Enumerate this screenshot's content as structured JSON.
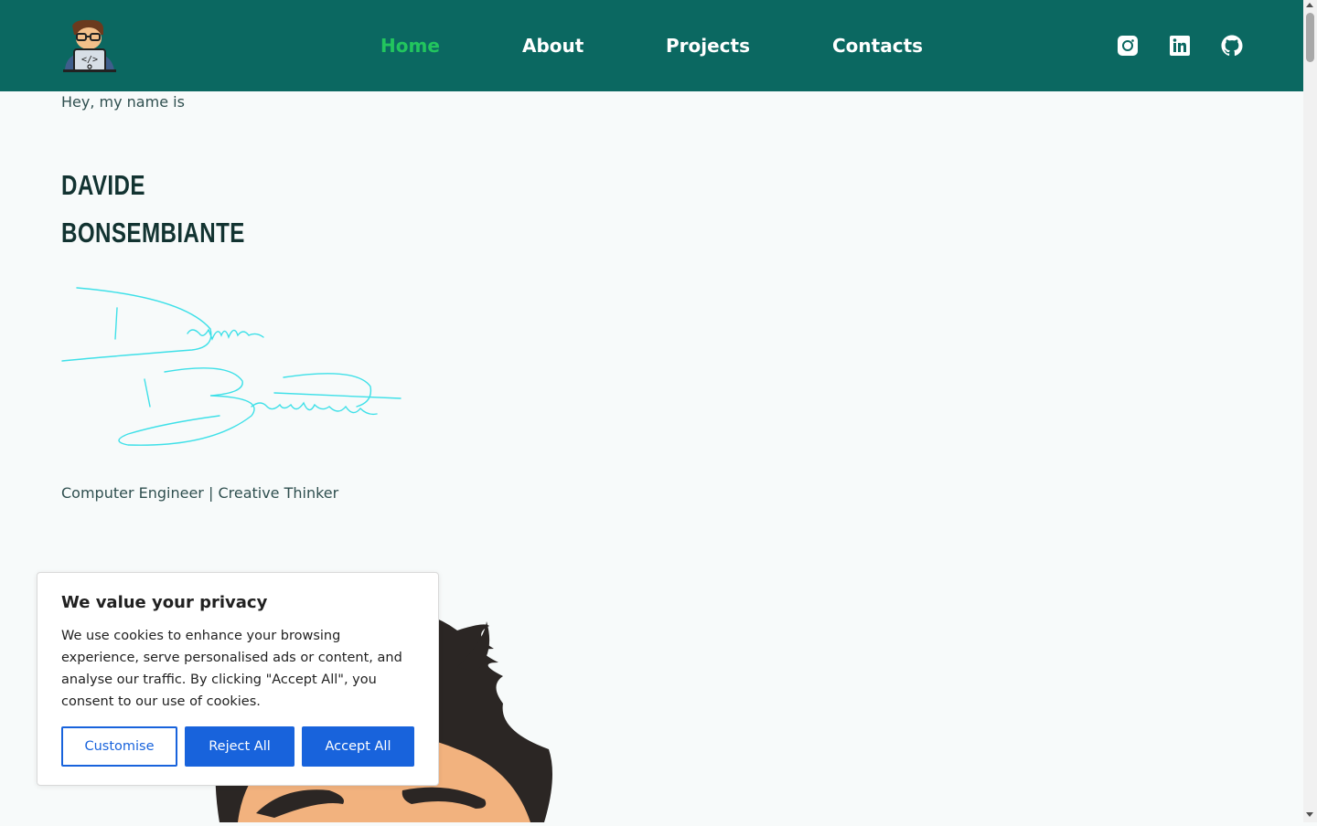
{
  "nav": {
    "items": [
      {
        "label": "Home",
        "active": true
      },
      {
        "label": "About",
        "active": false
      },
      {
        "label": "Projects",
        "active": false
      },
      {
        "label": "Contacts",
        "active": false
      }
    ],
    "social": [
      "instagram-icon",
      "linkedin-icon",
      "github-icon"
    ]
  },
  "hero": {
    "intro": "Hey, my name is",
    "first_name": "DAVIDE",
    "last_name": "BONSEMBIANTE",
    "signature_text": "Davide Bonsembiante",
    "tagline": "Computer Engineer | Creative Thinker"
  },
  "cookie": {
    "title": "We value your privacy",
    "text": "We use cookies to enhance your browsing experience, serve personalised ads or content, and analyse our traffic. By clicking \"Accept All\", you consent to our use of cookies.",
    "customise_label": "Customise",
    "reject_label": "Reject All",
    "accept_label": "Accept All"
  },
  "colors": {
    "header_bg": "#0b6861",
    "nav_active": "#22c55e",
    "signature": "#3ee0e8",
    "cookie_button": "#1863dc"
  }
}
